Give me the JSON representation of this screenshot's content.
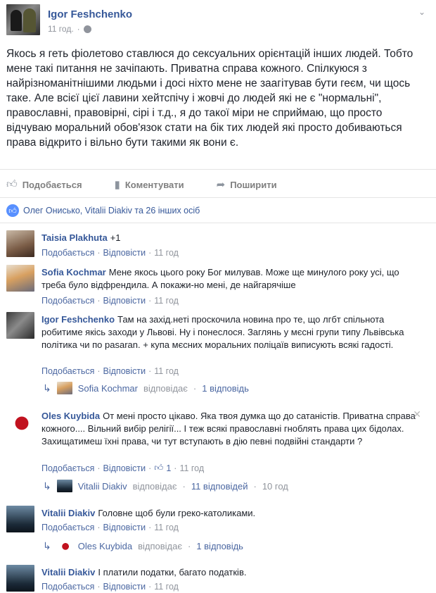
{
  "post": {
    "author": "Igor Feshchenko",
    "time": "11 год.",
    "separator": "·",
    "text": "Якось я геть фіолетово ставлюся до сексуальних орієнтацій інших людей. Тобто мене такі питання не зачіпають. Приватна справа кожного. Спілкуюся з найрізноманітнішими людьми і досі ніхто мене не заагітував бути геєм, чи щось таке. Але всієї цієї лавини хейтспічу і жовчі до людей які не є \"нормальні\", православні, правовірні, сірі і т.д., я до такої міри не сприймаю, що просто відчуваю моральний обов'язок стати на бік тих людей які просто добиваються права відкрито і вільно бути такими як вони є."
  },
  "actions": {
    "like": "Подобається",
    "comment": "Коментувати",
    "share": "Поширити"
  },
  "likes_summary": "Олег Онисько, Vitalii Diakiv та 26 інших осіб",
  "comments": [
    {
      "author": "Taisia Plakhuta",
      "text": "+1",
      "like": "Подобається",
      "reply": "Відповісти",
      "time": "11 год"
    },
    {
      "author": "Sofia Kochmar",
      "text": "Мене якось цього року Бог милував. Може ще минулого року усі, що треба було відфрендила. А покажи-но мені, де найгарячіше",
      "like": "Подобається",
      "reply": "Відповісти",
      "time": "11 год"
    },
    {
      "author": "Igor Feshchenko",
      "text": "Там на захід.неті проскочила новина про те, що лгбт спільнота робитиме якісь заходи у Львові. Ну і понеслося. Заглянь у мєсні групи типу Львівська політика чи по pasaran. + купа мєсних моральних поліцаїв виписують всякі гадості.",
      "like": "Подобається",
      "reply": "Відповісти",
      "time": "11 год",
      "replies_author": "Sofia Kochmar",
      "replies_verb": "відповідає",
      "replies_count": "1 відповідь"
    },
    {
      "author": "Oles Kuybida",
      "text": "От мені просто цікаво. Яка твоя думка що до сатаністів. Приватна справа кожного.... Вільний вибір релігії... І теж всякі православні гноблять права цих бідолах. Захищатимеш їхні права, чи тут вступають в дію певні подвійні стандарти ?",
      "like": "Подобається",
      "reply": "Відповісти",
      "reactions": "1",
      "time": "11 год",
      "replies_author": "Vitalii Diakiv",
      "replies_verb": "відповідає",
      "replies_count": "11 відповідей",
      "replies_time": "10 год"
    },
    {
      "author": "Vitalii Diakiv",
      "text": "Головне щоб були греко-католиками.",
      "like": "Подобається",
      "reply": "Відповісти",
      "time": "11 год",
      "replies_author": "Oles Kuybida",
      "replies_verb": "відповідає",
      "replies_count": "1 відповідь"
    },
    {
      "author": "Vitalii Diakiv",
      "text": "І платили податки, багато податків.",
      "like": "Подобається",
      "reply": "Відповісти",
      "time": "11 год"
    }
  ],
  "colors": {
    "link": "#365899",
    "meta": "#90949c",
    "text": "#1d2129"
  },
  "icons": [
    "chevron-down-icon",
    "globe-icon",
    "like-icon",
    "comment-icon",
    "share-icon",
    "reply-arrow-icon",
    "close-icon"
  ]
}
